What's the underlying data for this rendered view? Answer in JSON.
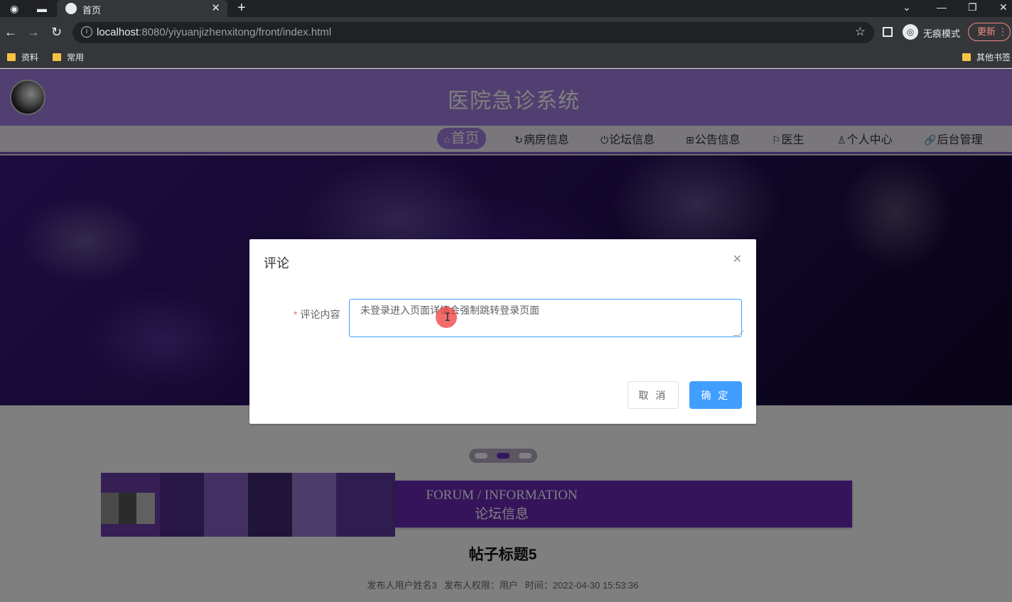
{
  "browser": {
    "tab_title": "首页",
    "url_host": "localhost",
    "url_rest": ":8080/yiyuanjizhenxitong/front/index.html",
    "incognito_label": "无痕模式",
    "update_label": "更新",
    "bookmarks": [
      "资料",
      "常用"
    ],
    "other_bookmarks": "其他书签"
  },
  "site": {
    "title": "医院急诊系统",
    "nav": [
      {
        "label": "首页",
        "icon": "home-icon"
      },
      {
        "label": "病房信息",
        "icon": "refresh-icon"
      },
      {
        "label": "论坛信息",
        "icon": "power-icon"
      },
      {
        "label": "公告信息",
        "icon": "grid-icon"
      },
      {
        "label": "医生",
        "icon": "flag-icon"
      },
      {
        "label": "个人中心",
        "icon": "user-icon"
      },
      {
        "label": "后台管理",
        "icon": "link-icon"
      }
    ]
  },
  "forum_section": {
    "title_en": "FORUM / INFORMATION",
    "title_cn": "论坛信息",
    "post_title": "帖子标题5",
    "meta_author": "发布人用户姓名3",
    "meta_role": "发布人权限：用户",
    "meta_time": "时间：2022-04-30 15:53:36"
  },
  "dialog": {
    "title": "评论",
    "label": "评论内容",
    "required_mark": "*",
    "textarea_value": "未登录进入页面详情会强制跳转登录页面",
    "cancel_label": "取 消",
    "ok_label": "确 定"
  },
  "colors": {
    "header": "#a07fe1",
    "primary": "#409eff",
    "forum_banner": "#6a28b8"
  }
}
